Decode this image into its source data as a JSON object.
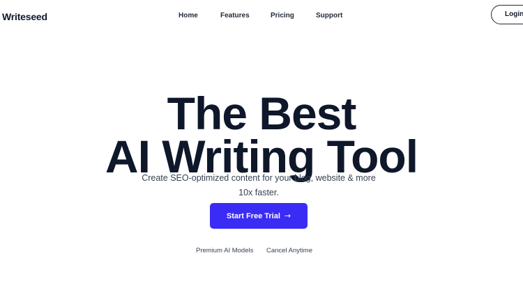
{
  "brand": {
    "name": "Writeseed"
  },
  "nav": {
    "links": [
      {
        "label": "Home"
      },
      {
        "label": "Features"
      },
      {
        "label": "Pricing"
      },
      {
        "label": "Support"
      }
    ],
    "login_label": "Login"
  },
  "hero": {
    "title_line1": "The Best",
    "title_line2": "AI Writing Tool",
    "subtitle": "Create SEO-optimized content for your blog, website & more 10x faster.",
    "cta_label": "Start Free Trial",
    "cta_icon": "arrow-right-icon",
    "features": [
      "Premium AI Models",
      "Cancel Anytime"
    ]
  },
  "colors": {
    "accent": "#3b2cf5",
    "text_dark": "#0f172a",
    "text_muted": "#374151",
    "background": "#ffffff"
  }
}
